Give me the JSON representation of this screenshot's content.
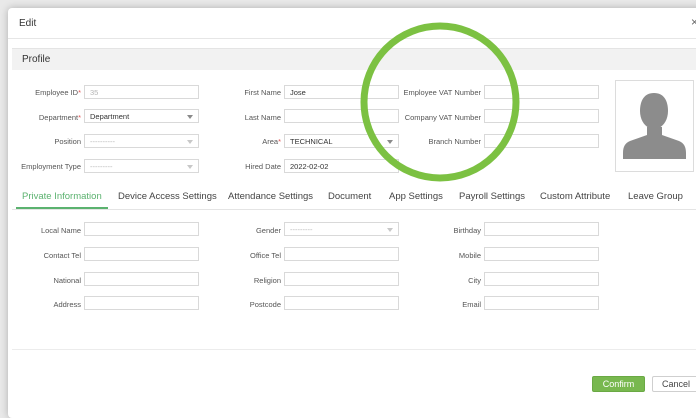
{
  "dialog": {
    "title": "Edit",
    "close_icon": "close-icon",
    "close_glyph": "×"
  },
  "profile": {
    "section_title": "Profile",
    "employee_id": {
      "label": "Employee ID",
      "required_mark": "*",
      "placeholder": "35"
    },
    "department": {
      "label": "Department",
      "required_mark": "*",
      "value": "Department"
    },
    "position": {
      "label": "Position",
      "value": "----------"
    },
    "employment_type": {
      "label": "Employment Type",
      "value": "---------"
    },
    "first_name": {
      "label": "First Name",
      "value": "Jose"
    },
    "last_name": {
      "label": "Last Name",
      "value": ""
    },
    "area": {
      "label": "Area",
      "required_mark": "*",
      "value": "TECHNICAL"
    },
    "hired_date": {
      "label": "Hired Date",
      "value": "2022-02-02"
    },
    "employee_vat": {
      "label": "Employee VAT Number",
      "value": ""
    },
    "company_vat": {
      "label": "Company VAT Number",
      "value": ""
    },
    "branch_number": {
      "label": "Branch Number",
      "value": ""
    },
    "photo_icon": "person-silhouette-icon"
  },
  "tabs": [
    {
      "label": "Private Information",
      "active": true
    },
    {
      "label": "Device Access Settings"
    },
    {
      "label": "Attendance Settings"
    },
    {
      "label": "Document"
    },
    {
      "label": "App Settings"
    },
    {
      "label": "Payroll Settings"
    },
    {
      "label": "Custom Attribute"
    },
    {
      "label": "Leave Group"
    }
  ],
  "private_info": {
    "local_name": {
      "label": "Local Name",
      "value": ""
    },
    "contact_tel": {
      "label": "Contact Tel",
      "value": ""
    },
    "national": {
      "label": "National",
      "value": ""
    },
    "address": {
      "label": "Address",
      "value": ""
    },
    "gender": {
      "label": "Gender",
      "value": "---------"
    },
    "office_tel": {
      "label": "Office Tel",
      "value": ""
    },
    "religion": {
      "label": "Religion",
      "value": ""
    },
    "postcode": {
      "label": "Postcode",
      "value": ""
    },
    "birthday": {
      "label": "Birthday",
      "value": ""
    },
    "mobile": {
      "label": "Mobile",
      "value": ""
    },
    "city": {
      "label": "City",
      "value": ""
    },
    "email": {
      "label": "Email",
      "value": ""
    }
  },
  "footer": {
    "confirm_label": "Confirm",
    "cancel_label": "Cancel"
  },
  "colors": {
    "accent": "#5bb26f",
    "confirm_bg": "#78b84f",
    "annotation_circle": "#7cc142",
    "required": "#e05050"
  }
}
